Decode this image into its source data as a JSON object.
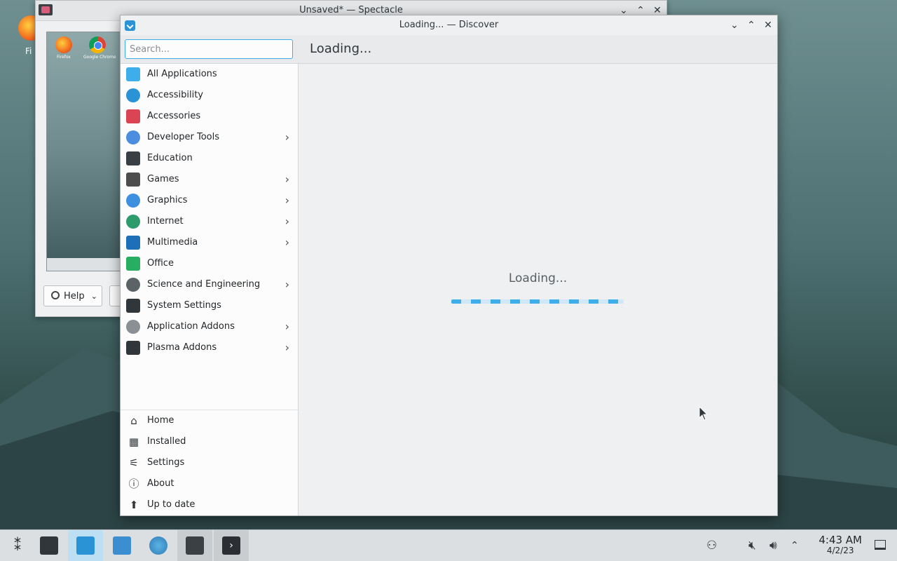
{
  "desktop": {
    "icon_label": "Fi"
  },
  "spectacle": {
    "title": "Unsaved* — Spectacle",
    "preview_labels": [
      "Firefox",
      "Google Chrome"
    ],
    "help_label": "Help"
  },
  "discover": {
    "title": "Loading... — Discover",
    "search_placeholder": "Search...",
    "page_heading": "Loading...",
    "categories": [
      {
        "label": "All Applications",
        "icon": "grid-icon",
        "color": "#3daee9"
      },
      {
        "label": "Accessibility",
        "icon": "accessibility-icon",
        "color": "#2a93d6"
      },
      {
        "label": "Accessories",
        "icon": "toolbox-icon",
        "color": "#da4453"
      },
      {
        "label": "Developer Tools",
        "icon": "hammer-icon",
        "color": "#4c8de0",
        "submenu": true
      },
      {
        "label": "Education",
        "icon": "chalkboard-icon",
        "color": "#3a3f44"
      },
      {
        "label": "Games",
        "icon": "gamepad-icon",
        "color": "#4d4d4d",
        "submenu": true
      },
      {
        "label": "Graphics",
        "icon": "palette-icon",
        "color": "#3d8fe0",
        "submenu": true
      },
      {
        "label": "Internet",
        "icon": "globe-icon",
        "color": "#2e9b6d",
        "submenu": true
      },
      {
        "label": "Multimedia",
        "icon": "monitor-icon",
        "color": "#1d6fb8",
        "submenu": true
      },
      {
        "label": "Office",
        "icon": "document-icon",
        "color": "#27ae60"
      },
      {
        "label": "Science and Engineering",
        "icon": "flask-icon",
        "color": "#5c6366",
        "submenu": true
      },
      {
        "label": "System Settings",
        "icon": "sliders-icon",
        "color": "#31363b"
      },
      {
        "label": "Application Addons",
        "icon": "dots-icon",
        "color": "#8a9094",
        "submenu": true
      },
      {
        "label": "Plasma Addons",
        "icon": "plasma-icon",
        "color": "#31363b",
        "submenu": true
      }
    ],
    "nav": [
      {
        "label": "Home",
        "icon": "home-icon",
        "glyph": "⌂"
      },
      {
        "label": "Installed",
        "icon": "installed-icon",
        "glyph": "▦"
      },
      {
        "label": "Settings",
        "icon": "settings-icon",
        "glyph": "⚟"
      },
      {
        "label": "About",
        "icon": "info-icon",
        "glyph": "ⓘ"
      },
      {
        "label": "Up to date",
        "icon": "upload-icon",
        "glyph": "⬆"
      }
    ],
    "loading_text": "Loading..."
  },
  "taskbar": {
    "time": "4:43 AM",
    "date": "4/2/23"
  },
  "colors": {
    "accent": "#3daee9",
    "taskbar_bg": "#dcdfe1",
    "window_bg": "#eff0f1"
  }
}
